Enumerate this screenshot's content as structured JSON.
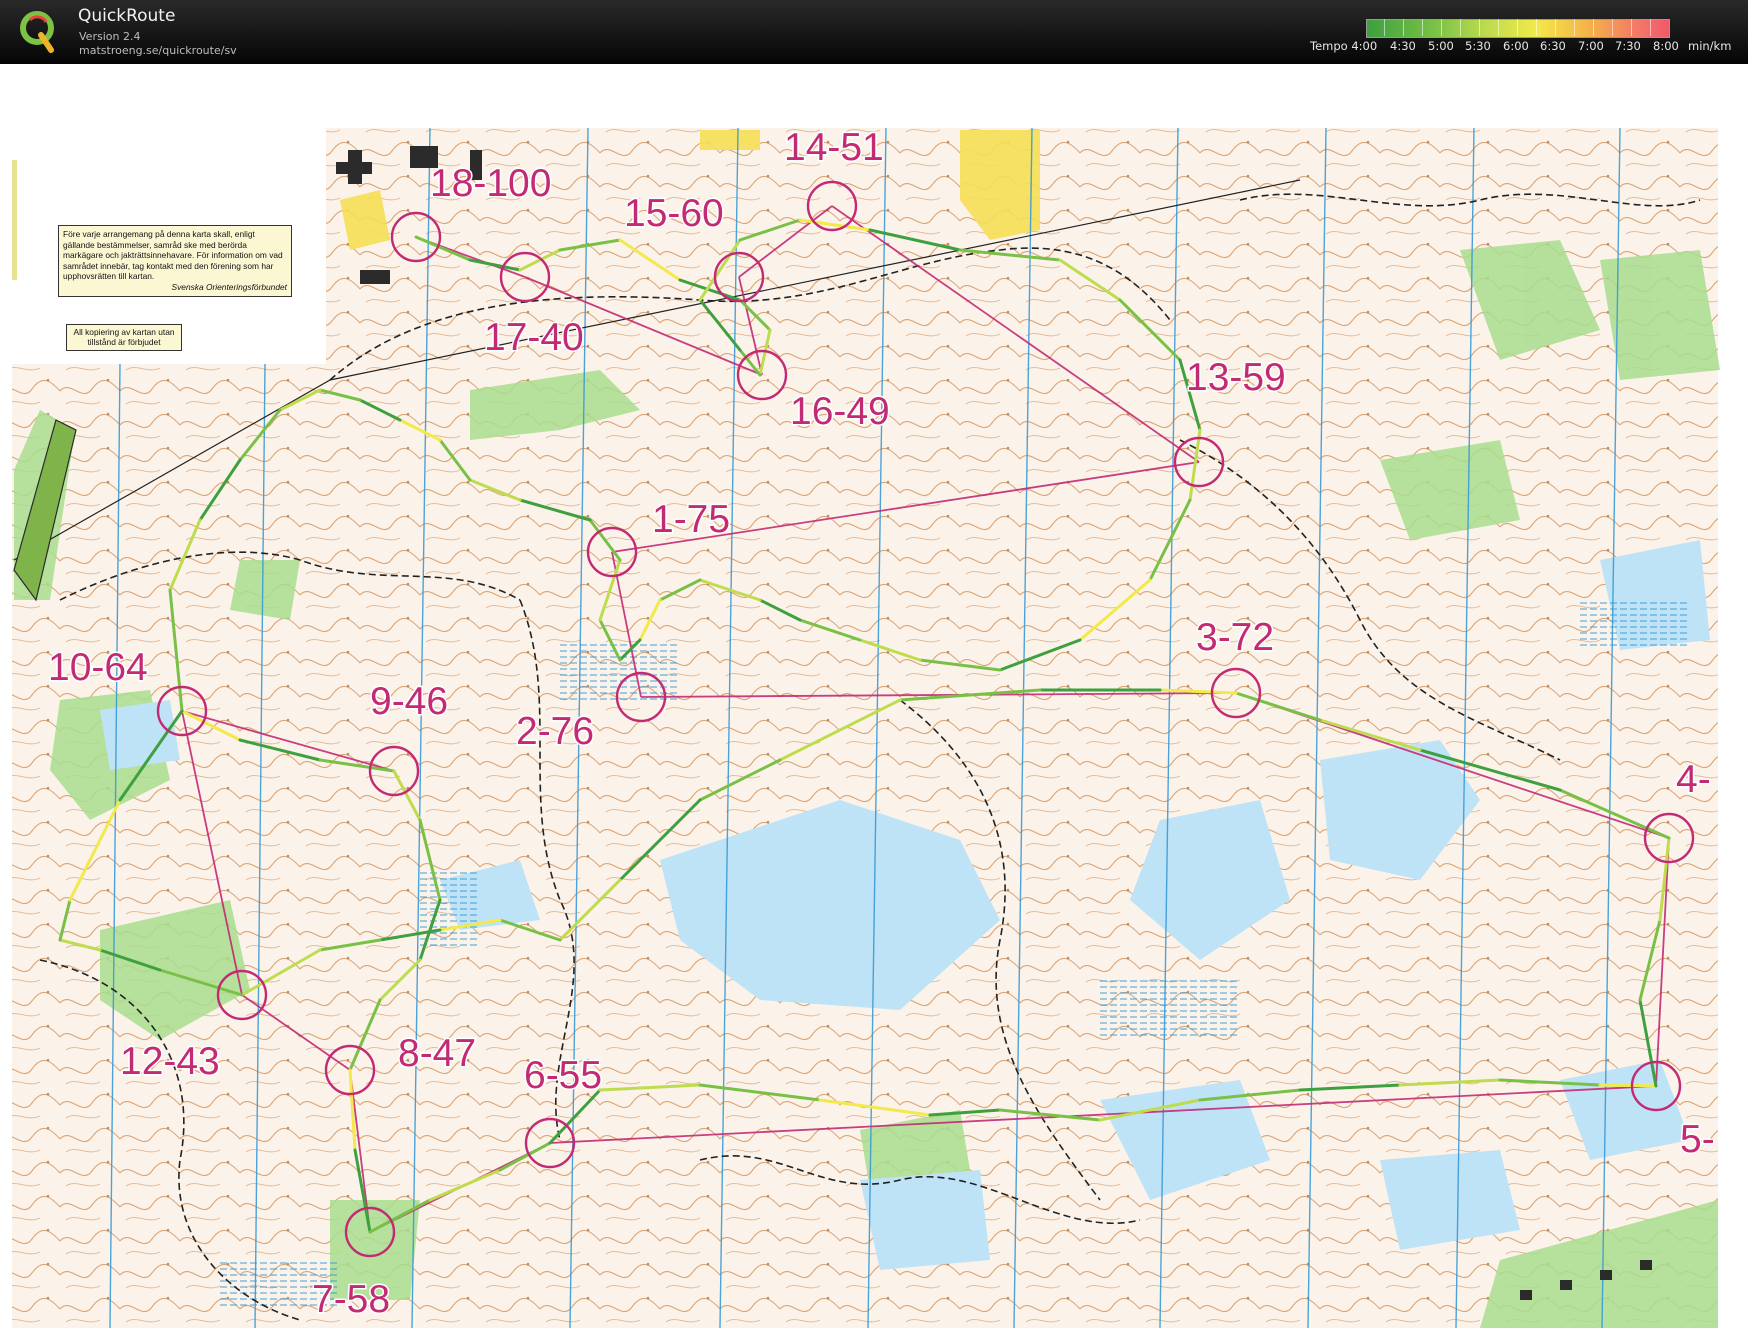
{
  "app": {
    "title": "QuickRoute",
    "version": "Version 2.4",
    "url": "matstroeng.se/quickroute/sv"
  },
  "tempo": {
    "label": "Tempo 4:00",
    "ticks": [
      "4:30",
      "5:00",
      "5:30",
      "6:00",
      "6:30",
      "7:00",
      "7:30",
      "8:00"
    ],
    "unit": "min/km",
    "colors": [
      "#3ea03e",
      "#79c046",
      "#bfdc4e",
      "#f2e94a",
      "#f4b04a",
      "#f27868",
      "#ef5a6a"
    ]
  },
  "map": {
    "legal_note": "Före varje arrangemang på denna karta skall, enligt gällande bestämmelser, samråd ske med berörda markägare och jakträttsinnehavare. För information om vad samrådet innebär, tag kontakt med den förening som har upphovsrätten till kartan.",
    "legal_org": "Svenska Orienteringsförbundet",
    "copy_note": "All kopiering av kartan utan tillstånd är förbjudet",
    "controls": [
      {
        "label": "1-75"
      },
      {
        "label": "2-76"
      },
      {
        "label": "3-72"
      },
      {
        "label": "4-"
      },
      {
        "label": "5-"
      },
      {
        "label": "6-55"
      },
      {
        "label": "7-58"
      },
      {
        "label": "8-47"
      },
      {
        "label": "9-46"
      },
      {
        "label": "10-64"
      },
      {
        "label": "12-43"
      },
      {
        "label": "13-59"
      },
      {
        "label": "14-51"
      },
      {
        "label": "15-60"
      },
      {
        "label": "16-49"
      },
      {
        "label": "17-40"
      },
      {
        "label": "18-100"
      }
    ]
  }
}
